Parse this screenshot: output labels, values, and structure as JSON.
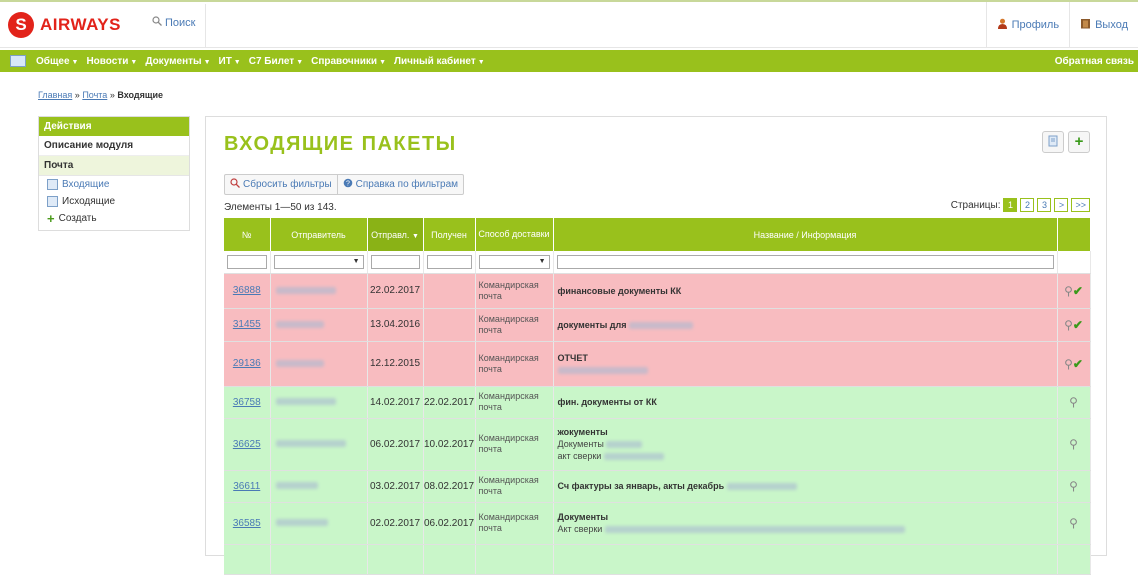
{
  "header": {
    "brand_letter": "S",
    "brand_name": "AIRWAYS",
    "search_label": "Поиск",
    "profile_label": "Профиль",
    "logout_label": "Выход"
  },
  "nav": {
    "items": [
      "Общее",
      "Новости",
      "Документы",
      "ИТ",
      "С7 Билет",
      "Справочники",
      "Личный кабинет"
    ],
    "feedback": "Обратная связь"
  },
  "breadcrumb": {
    "home": "Главная",
    "sep": "»",
    "mail": "Почта",
    "current": "Входящие"
  },
  "sidebar": {
    "header": "Действия",
    "module_desc": "Описание модуля",
    "section": "Почта",
    "items": [
      "Входящие",
      "Исходящие",
      "Создать"
    ]
  },
  "main": {
    "title": "ВХОДЯЩИЕ ПАКЕТЫ",
    "reset_filters": "Сбросить фильтры",
    "filter_help": "Справка по фильтрам",
    "count_text": "Элементы 1—50 из 143.",
    "pages_label": "Страницы:",
    "pages": [
      "1",
      "2",
      "3",
      ">",
      ">>"
    ]
  },
  "table": {
    "columns": [
      "№",
      "Отправитель",
      "Отправл.",
      "Получен",
      "Способ доставки",
      "Название / Информация"
    ],
    "rows": [
      {
        "num": "36888",
        "sent": "22.02.2017",
        "received": "",
        "delivery": "Командирская почта",
        "title": "финансовые документы КК",
        "sub": [],
        "status": "red"
      },
      {
        "num": "31455",
        "sent": "13.04.2016",
        "received": "",
        "delivery": "Командирская почта",
        "title": "документы для",
        "sub": [],
        "status": "red"
      },
      {
        "num": "29136",
        "sent": "12.12.2015",
        "received": "",
        "delivery": "Командирская почта",
        "title": "ОТЧЕТ",
        "sub": [],
        "status": "red"
      },
      {
        "num": "36758",
        "sent": "14.02.2017",
        "received": "22.02.2017",
        "delivery": "Командирская почта",
        "title": "фин. документы от КК",
        "sub": [],
        "status": "green"
      },
      {
        "num": "36625",
        "sent": "06.02.2017",
        "received": "10.02.2017",
        "delivery": "Командирская почта",
        "title": "жокументы",
        "sub": [
          "Документы",
          "акт сверки"
        ],
        "status": "green"
      },
      {
        "num": "36611",
        "sent": "03.02.2017",
        "received": "08.02.2017",
        "delivery": "Командирская почта",
        "title": "Сч фактуры за январь, акты декабрь",
        "sub": [],
        "status": "green"
      },
      {
        "num": "36585",
        "sent": "02.02.2017",
        "received": "06.02.2017",
        "delivery": "Командирская почта",
        "title": "Документы",
        "sub": [
          "Акт сверки"
        ],
        "status": "green"
      }
    ]
  },
  "colors": {
    "accent": "#99c11c",
    "brand": "#e2231a",
    "row_red": "#f8bcc0",
    "row_green": "#c9f6c9",
    "link": "#4a7ab5"
  }
}
